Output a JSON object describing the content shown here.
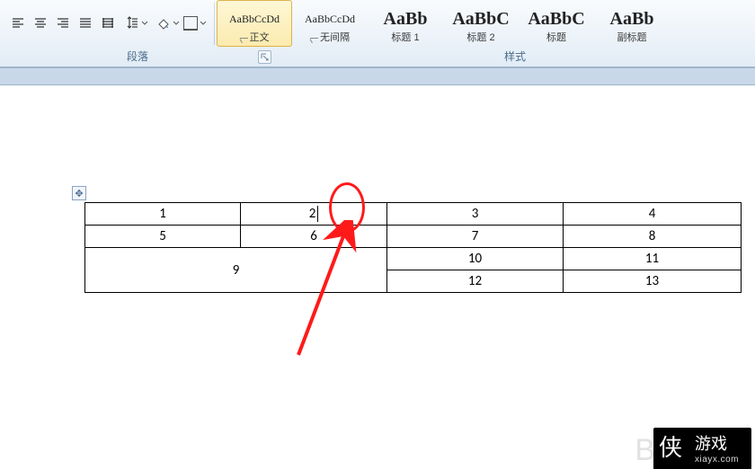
{
  "ribbon": {
    "paragraph": {
      "label": "段落",
      "buttonsTop": [
        "align-left",
        "align-center",
        "align-right",
        "align-justify",
        "align-distribute",
        "line-spacing",
        "shading",
        "borders"
      ]
    },
    "styles": {
      "label": "样式",
      "items": [
        {
          "sample": "AaBbCcDd",
          "name": "正文",
          "big": false,
          "selected": true,
          "jmark": true
        },
        {
          "sample": "AaBbCcDd",
          "name": "无间隔",
          "big": false,
          "selected": false,
          "jmark": true
        },
        {
          "sample": "AaBb",
          "name": "标题 1",
          "big": true,
          "selected": false,
          "jmark": false
        },
        {
          "sample": "AaBbC",
          "name": "标题 2",
          "big": true,
          "selected": false,
          "jmark": false
        },
        {
          "sample": "AaBbC",
          "name": "标题",
          "big": true,
          "selected": false,
          "jmark": false
        },
        {
          "sample": "AaBb",
          "name": "副标题",
          "big": true,
          "selected": false,
          "jmark": false
        }
      ]
    }
  },
  "table": {
    "rows": [
      {
        "cells": [
          "1",
          "2",
          "3",
          "4"
        ],
        "spans": [
          1,
          1,
          1,
          1
        ]
      },
      {
        "cells": [
          "5",
          "6",
          "7",
          "8"
        ],
        "spans": [
          1,
          1,
          1,
          1
        ]
      },
      {
        "cells": [
          "9",
          "10",
          "11"
        ],
        "spans": [
          2,
          1,
          1
        ],
        "mergeDown": [
          true,
          false,
          false
        ]
      },
      {
        "cells": [
          "12",
          "13"
        ],
        "spans": [
          1,
          1
        ],
        "skipFirst": true
      }
    ],
    "caretCell": {
      "row": 0,
      "col": 1
    }
  },
  "watermark": {
    "faint": "Ba",
    "brand": "游戏",
    "logo": "侠",
    "url": "xiayx.com"
  },
  "icons": {
    "tri": "▾"
  }
}
